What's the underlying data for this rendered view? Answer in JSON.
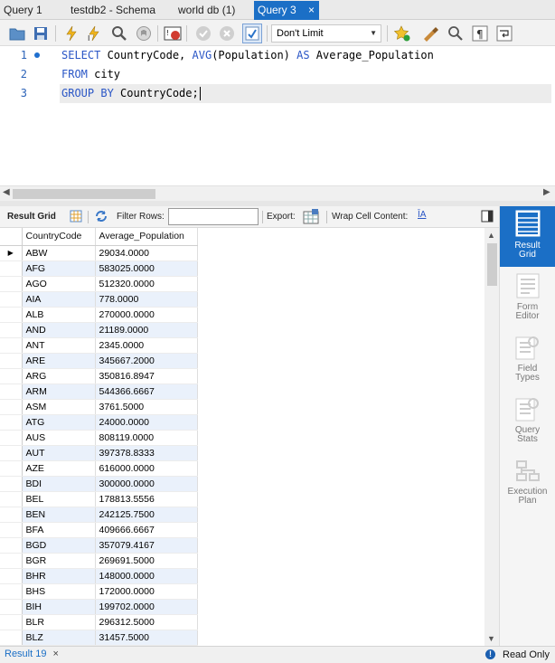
{
  "tabs": [
    {
      "label": "Query 1"
    },
    {
      "label": "testdb2 - Schema"
    },
    {
      "label": "world db (1)"
    },
    {
      "label": "Query 3",
      "close": "×"
    }
  ],
  "toolbar": {
    "limit": "Don't Limit",
    "icons": [
      "open-folder-icon",
      "save-icon",
      "execute-icon",
      "execute-current-icon",
      "explain-icon",
      "stop-icon",
      "toggle-error-icon",
      "commit-icon",
      "rollback-icon",
      "autocommit-icon",
      "bookmark-icon",
      "beautify-icon",
      "find-icon",
      "invisible-chars-icon",
      "wrap-icon"
    ]
  },
  "editor": {
    "lines": [
      {
        "num": "1",
        "parts": [
          [
            "kw",
            "SELECT"
          ],
          [
            "t",
            " CountryCode, "
          ],
          [
            "kw",
            "AVG"
          ],
          [
            "t",
            "(Population) "
          ],
          [
            "kw",
            "AS"
          ],
          [
            "t",
            " Average_Population"
          ]
        ]
      },
      {
        "num": "2",
        "parts": [
          [
            "kw",
            "FROM"
          ],
          [
            "t",
            " city"
          ]
        ]
      },
      {
        "num": "3",
        "parts": [
          [
            "kw",
            "GROUP BY"
          ],
          [
            "t",
            " CountryCode;"
          ]
        ]
      }
    ]
  },
  "result_toolbar": {
    "result_grid": "Result Grid",
    "filter_rows": "Filter Rows:",
    "export": "Export:",
    "wrap_cell": "Wrap Cell Content:"
  },
  "grid": {
    "columns": [
      "CountryCode",
      "Average_Population"
    ],
    "rows": [
      [
        "ABW",
        "29034.0000"
      ],
      [
        "AFG",
        "583025.0000"
      ],
      [
        "AGO",
        "512320.0000"
      ],
      [
        "AIA",
        "778.0000"
      ],
      [
        "ALB",
        "270000.0000"
      ],
      [
        "AND",
        "21189.0000"
      ],
      [
        "ANT",
        "2345.0000"
      ],
      [
        "ARE",
        "345667.2000"
      ],
      [
        "ARG",
        "350816.8947"
      ],
      [
        "ARM",
        "544366.6667"
      ],
      [
        "ASM",
        "3761.5000"
      ],
      [
        "ATG",
        "24000.0000"
      ],
      [
        "AUS",
        "808119.0000"
      ],
      [
        "AUT",
        "397378.8333"
      ],
      [
        "AZE",
        "616000.0000"
      ],
      [
        "BDI",
        "300000.0000"
      ],
      [
        "BEL",
        "178813.5556"
      ],
      [
        "BEN",
        "242125.7500"
      ],
      [
        "BFA",
        "409666.6667"
      ],
      [
        "BGD",
        "357079.4167"
      ],
      [
        "BGR",
        "269691.5000"
      ],
      [
        "BHR",
        "148000.0000"
      ],
      [
        "BHS",
        "172000.0000"
      ],
      [
        "BIH",
        "199702.0000"
      ],
      [
        "BLR",
        "296312.5000"
      ],
      [
        "BLZ",
        "31457.5000"
      ]
    ]
  },
  "side_panel": [
    {
      "label1": "Result",
      "label2": "Grid",
      "active": true
    },
    {
      "label1": "Form",
      "label2": "Editor"
    },
    {
      "label1": "Field",
      "label2": "Types"
    },
    {
      "label1": "Query",
      "label2": "Stats"
    },
    {
      "label1": "Execution",
      "label2": "Plan"
    }
  ],
  "status": {
    "result_tab": "Result 19",
    "close": "×",
    "read_only": "Read Only"
  }
}
